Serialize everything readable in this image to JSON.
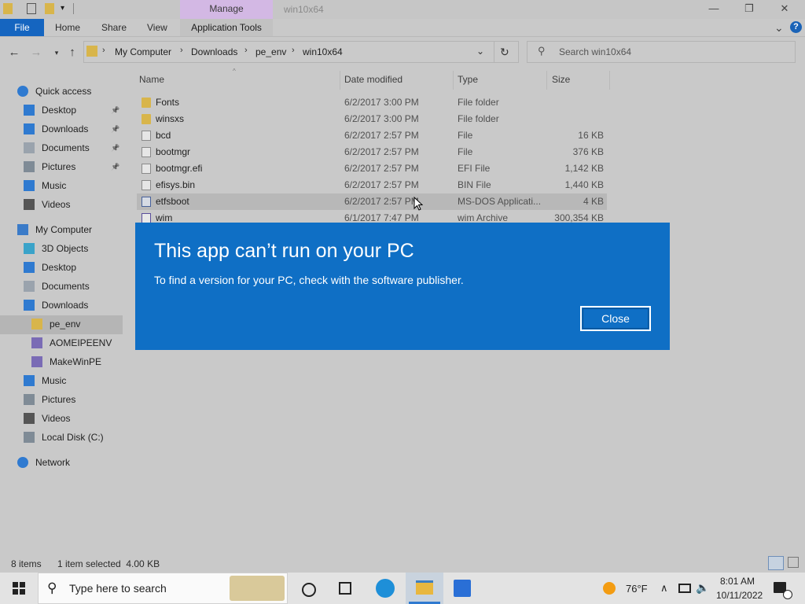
{
  "window": {
    "manage_tab": "Manage",
    "title": "win10x64",
    "minimize_glyph": "—",
    "maximize_glyph": "❐",
    "close_glyph": "✕"
  },
  "ribbon": {
    "tabs": [
      "File",
      "Home",
      "Share",
      "View",
      "Application Tools"
    ],
    "collapse_glyph": "⌄",
    "help_glyph": "?"
  },
  "address": {
    "breadcrumbs": [
      "My Computer",
      "Downloads",
      "pe_env",
      "win10x64"
    ],
    "search_placeholder": "Search win10x64"
  },
  "sidebar": {
    "items": [
      {
        "label": "Quick access",
        "icon": "star-icon"
      },
      {
        "label": "Desktop",
        "icon": "desktop-icon",
        "pinned": true
      },
      {
        "label": "Downloads",
        "icon": "download-arrow-icon",
        "pinned": true
      },
      {
        "label": "Documents",
        "icon": "documents-icon",
        "pinned": true
      },
      {
        "label": "Pictures",
        "icon": "pictures-icon",
        "pinned": true
      },
      {
        "label": "Music",
        "icon": "music-icon"
      },
      {
        "label": "Videos",
        "icon": "videos-icon"
      },
      {
        "label": "My Computer",
        "icon": "computer-icon"
      },
      {
        "label": "3D Objects",
        "icon": "3d-objects-icon"
      },
      {
        "label": "Desktop",
        "icon": "desktop-icon"
      },
      {
        "label": "Documents",
        "icon": "documents-icon"
      },
      {
        "label": "Downloads",
        "icon": "download-arrow-icon"
      },
      {
        "label": "pe_env",
        "icon": "folder-icon"
      },
      {
        "label": "AOMEIPEENV",
        "icon": "zip-folder-icon"
      },
      {
        "label": "MakeWinPE",
        "icon": "zip-folder-icon"
      },
      {
        "label": "Music",
        "icon": "music-icon"
      },
      {
        "label": "Pictures",
        "icon": "pictures-icon"
      },
      {
        "label": "Videos",
        "icon": "videos-icon"
      },
      {
        "label": "Local Disk (C:)",
        "icon": "drive-icon"
      },
      {
        "label": "Network",
        "icon": "network-icon"
      }
    ]
  },
  "columns": [
    "Name",
    "Date modified",
    "Type",
    "Size"
  ],
  "files": [
    {
      "name": "Fonts",
      "date": "6/2/2017 3:00 PM",
      "type": "File folder",
      "size": "",
      "icon": "folder"
    },
    {
      "name": "winsxs",
      "date": "6/2/2017 3:00 PM",
      "type": "File folder",
      "size": "",
      "icon": "folder"
    },
    {
      "name": "bcd",
      "date": "6/2/2017 2:57 PM",
      "type": "File",
      "size": "16 KB",
      "icon": "file"
    },
    {
      "name": "bootmgr",
      "date": "6/2/2017 2:57 PM",
      "type": "File",
      "size": "376 KB",
      "icon": "file"
    },
    {
      "name": "bootmgr.efi",
      "date": "6/2/2017 2:57 PM",
      "type": "EFI File",
      "size": "1,142 KB",
      "icon": "file"
    },
    {
      "name": "efisys.bin",
      "date": "6/2/2017 2:57 PM",
      "type": "BIN File",
      "size": "1,440 KB",
      "icon": "file"
    },
    {
      "name": "etfsboot",
      "date": "6/2/2017 2:57 PM",
      "type": "MS-DOS Applicati...",
      "size": "4 KB",
      "icon": "exe",
      "selected": true
    },
    {
      "name": "wim",
      "date": "6/1/2017 7:47 PM",
      "type": "wim Archive",
      "size": "300,354 KB",
      "icon": "wim"
    }
  ],
  "status": {
    "items": "8 items",
    "selected": "1 item selected  4.00 KB"
  },
  "dialog": {
    "title": "This app can’t run on your PC",
    "message": "To find a version for your PC, check with the software publisher.",
    "close_label": "Close"
  },
  "taskbar": {
    "search_placeholder": "Type here to search",
    "weather": "76°F",
    "time": "8:01 AM",
    "date": "10/11/2022"
  },
  "colors": {
    "dialog_bg": "#0f6fc5",
    "file_tab": "#1565c0",
    "manage_tab": "#d3b8e4"
  }
}
